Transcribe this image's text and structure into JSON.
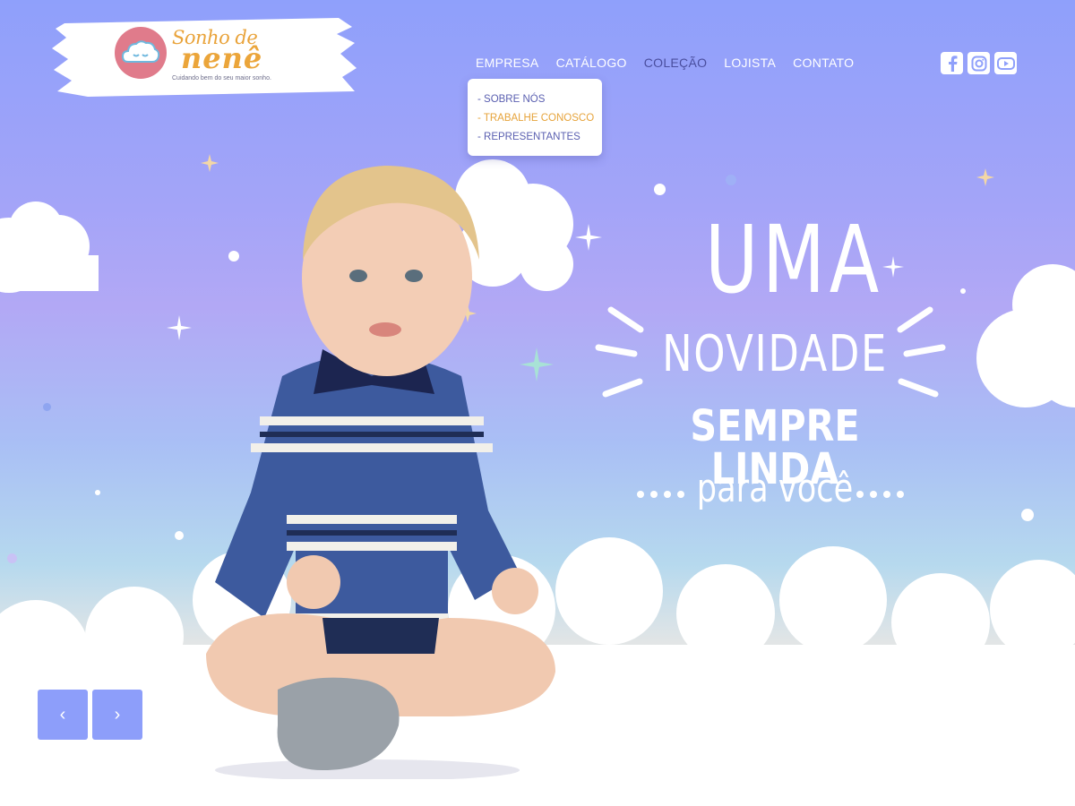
{
  "brand": {
    "name_line1": "Sonho de",
    "name_line2": "nenê",
    "tagline": "Cuidando bem do seu maior sonho."
  },
  "nav": {
    "items": [
      {
        "label": "EMPRESA",
        "active": false
      },
      {
        "label": "CATÁLOGO",
        "active": false
      },
      {
        "label": "COLEÇÃO",
        "active": true
      },
      {
        "label": "LOJISTA",
        "active": false
      },
      {
        "label": "CONTATO",
        "active": false
      }
    ],
    "dropdown": [
      {
        "label": "- SOBRE NÓS"
      },
      {
        "label": "- TRABALHE CONOSCO"
      },
      {
        "label": "- REPRESENTANTES"
      }
    ]
  },
  "social": [
    {
      "icon": "facebook-icon"
    },
    {
      "icon": "instagram-icon"
    },
    {
      "icon": "youtube-icon"
    }
  ],
  "hero": {
    "line1": "UMA",
    "line2": "NOVIDADE",
    "line3": "SEMPRE LINDA",
    "line4": "para você"
  },
  "slider": {
    "prev_label": "‹",
    "next_label": "›"
  },
  "colors": {
    "nav_active": "#4a4e9e",
    "dropdown_text": "#5a5fb0",
    "dropdown_highlight": "#e6a33a",
    "brand_orange": "#eba53a",
    "badge_pink": "#e07b8b",
    "arrow_bg": "#8d9efa"
  }
}
